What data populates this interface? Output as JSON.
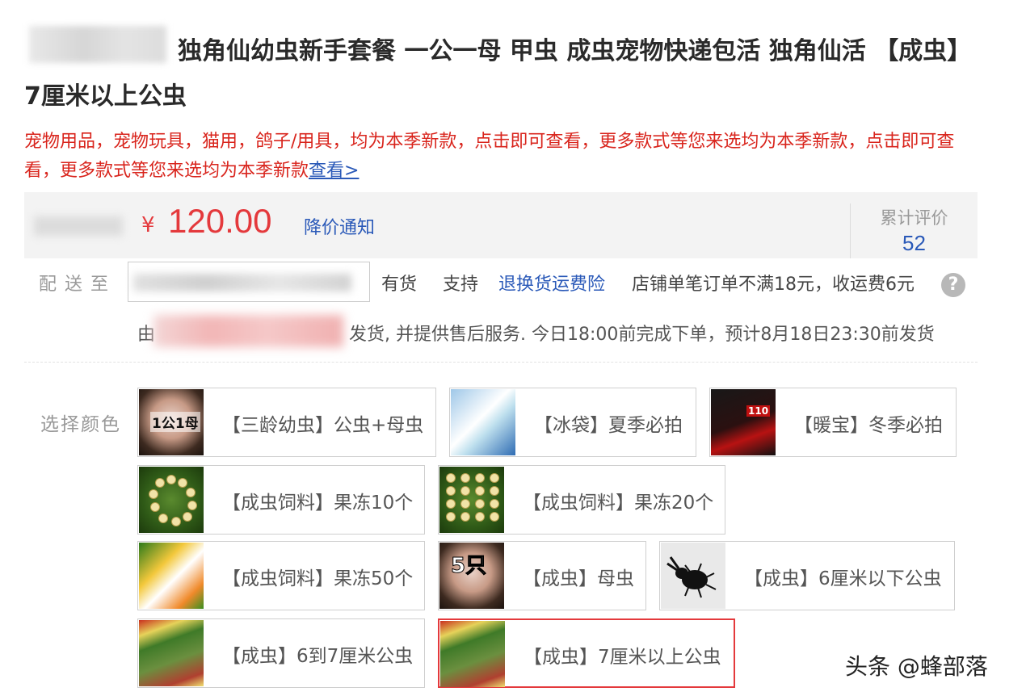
{
  "product": {
    "title": "独角仙幼虫新手套餐 一公一母 甲虫 成虫宠物快递包活 独角仙活 【成虫】7厘米以上公虫"
  },
  "promo": {
    "text": "宠物用品，宠物玩具，猫用，鸽子/用具，均为本季新款，点击即可查看，更多款式等您来选均为本季新款，点击即可查看，更多款式等您来选均为本季新款",
    "link_label": "查看>"
  },
  "price": {
    "currency": "¥",
    "value": "120.00",
    "notice_label": "降价通知",
    "review_label": "累计评价",
    "review_count": "52"
  },
  "shipping": {
    "label": "配送至",
    "stock": "有货",
    "support": "支持",
    "insurance_link": "退换货运费险",
    "fee_text": "店铺单笔订单不满18元，收运费6元",
    "help_icon": "?",
    "seller_prefix": "由",
    "seller_suffix": "发货, 并提供售后服务. 今日18:00前完成下单，预计8月18日23:30前发货"
  },
  "options": {
    "label": "选择颜色",
    "items": [
      {
        "text": "【三龄幼虫】公虫+母虫",
        "thumb_tag": "1公1母",
        "selected": false
      },
      {
        "text": "【冰袋】夏季必拍",
        "thumb_tag": "",
        "selected": false
      },
      {
        "text": "【暖宝】冬季必拍",
        "thumb_tag": "110",
        "selected": false
      },
      {
        "text": "【成虫饲料】果冻10个",
        "thumb_tag": "",
        "selected": false
      },
      {
        "text": "【成虫饲料】果冻20个",
        "thumb_tag": "",
        "selected": false
      },
      {
        "text": "【成虫饲料】果冻50个",
        "thumb_tag": "",
        "selected": false
      },
      {
        "text": "【成虫】母虫",
        "thumb_tag": "5只",
        "selected": false
      },
      {
        "text": "【成虫】6厘米以下公虫",
        "thumb_tag": "",
        "selected": false
      },
      {
        "text": "【成虫】6到7厘米公虫",
        "thumb_tag": "",
        "selected": false
      },
      {
        "text": "【成虫】7厘米以上公虫",
        "thumb_tag": "",
        "selected": true
      }
    ]
  },
  "watermark": "头条 @蜂部落"
}
